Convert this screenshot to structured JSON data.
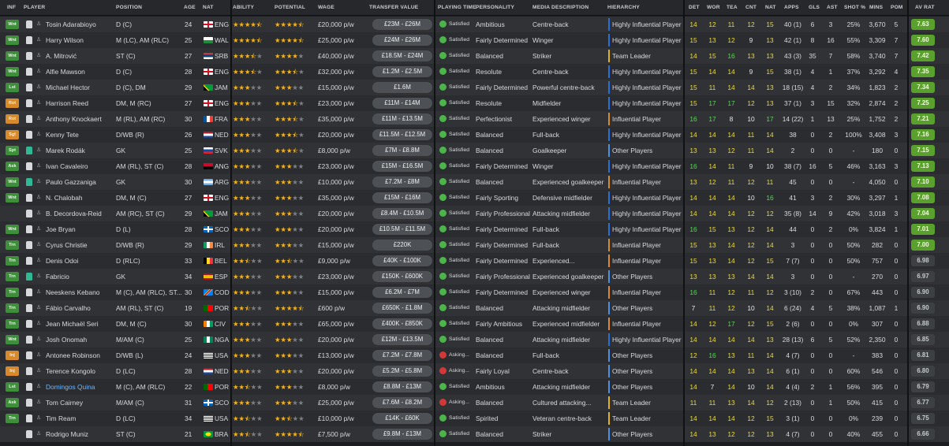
{
  "headers": {
    "inf": "INF",
    "player": "PLAYER",
    "position": "POSITION",
    "age": "AGE",
    "nat": "NAT",
    "ability": "ABILITY",
    "potential": "POTENTIAL",
    "wage": "WAGE",
    "transfer_value": "TRANSFER VALUE",
    "playing_time": "PLAYING TIME",
    "personality": "PERSONALITY",
    "media": "MEDIA DESCRIPTION",
    "hierarchy": "HIERARCHY",
    "det": "DET",
    "wor": "WOR",
    "tea": "TEA",
    "cnt": "CNT",
    "nat2": "NAT",
    "apps": "APPS",
    "gls": "GLS",
    "ast": "AST",
    "shot": "SHOT %",
    "mins": "MINS",
    "pom": "POM",
    "avrat": "AV RAT"
  },
  "colors": {
    "inf_wnt": "#3e8e3b",
    "inf_lst": "#3e8e3b",
    "inf_rot": "#d8892a",
    "inf_sgl": "#d8892a",
    "inf_spt": "#3e8e3b",
    "inf_trn": "#3e8e3b",
    "inf_inj": "#d8892a",
    "hier_top": "#2a6fd6",
    "hier_leader": "#e2b21c",
    "hier_infl": "#d8892a",
    "hier_other": "#4d8fe0",
    "star_on": "#f2b31f",
    "star_off": "#7c7f84",
    "satisfied": "#4bb54a",
    "asking": "#d23838"
  },
  "players": [
    {
      "inf": "Wnt",
      "name": "Tosin Adarabioyo",
      "pos": "D (C)",
      "age": "24",
      "nat": "ENG",
      "ab": 4.5,
      "pot": 4.5,
      "wage": "£20,000 p/w",
      "tv": "£23M - £26M",
      "pt": "Satisfied",
      "pers": "Ambitious",
      "media": "Centre-back",
      "hier": "Highly Influential Player",
      "det": "14",
      "wor": "12",
      "tea": "11",
      "cnt": "12",
      "nat2": "15",
      "apps": "40 (1)",
      "gls": "6",
      "ast": "3",
      "shot": "25%",
      "mins": "3,670",
      "pom": "5",
      "av": "7.63"
    },
    {
      "inf": "Wnt",
      "name": "Harry Wilson",
      "pos": "M (LC), AM (RLC)",
      "age": "25",
      "nat": "WAL",
      "ab": 4.5,
      "pot": 4.5,
      "wage": "£25,000 p/w",
      "tv": "£24M - £26M",
      "pt": "Satisfied",
      "pers": "Fairly Determined",
      "media": "Winger",
      "hier": "Highly Influential Player",
      "det": "15",
      "wor": "13",
      "tea": "12",
      "cnt": "9",
      "nat2": "13",
      "apps": "42 (1)",
      "gls": "8",
      "ast": "16",
      "shot": "55%",
      "mins": "3,309",
      "pom": "7",
      "av": "7.60"
    },
    {
      "inf": "Wnt",
      "name": "A. Mitrović",
      "pos": "ST (C)",
      "age": "27",
      "nat": "SRB",
      "ab": 3.5,
      "pot": 4,
      "wage": "£40,000 p/w",
      "tv": "£18.5M - £24M",
      "pt": "Satisfied",
      "pers": "Balanced",
      "media": "Striker",
      "hier": "Team Leader",
      "det": "14",
      "wor": "15",
      "tea": "16",
      "cnt": "13",
      "nat2": "13",
      "apps": "43 (3)",
      "gls": "35",
      "ast": "7",
      "shot": "58%",
      "mins": "3,740",
      "pom": "7",
      "av": "7.42"
    },
    {
      "inf": "Wnt",
      "name": "Alfie Mawson",
      "pos": "D (C)",
      "age": "28",
      "nat": "ENG",
      "ab": 3.5,
      "pot": 3.5,
      "wage": "£32,000 p/w",
      "tv": "£1.2M - £2.5M",
      "pt": "Satisfied",
      "pers": "Resolute",
      "media": "Centre-back",
      "hier": "Highly Influential Player",
      "det": "15",
      "wor": "14",
      "tea": "14",
      "cnt": "9",
      "nat2": "15",
      "apps": "38 (1)",
      "gls": "4",
      "ast": "1",
      "shot": "37%",
      "mins": "3,292",
      "pom": "4",
      "av": "7.35"
    },
    {
      "inf": "Lst",
      "name": "Michael Hector",
      "pos": "D (C), DM",
      "age": "29",
      "nat": "JAM",
      "ab": 3,
      "pot": 3,
      "wage": "£15,000 p/w",
      "tv": "£1.6M",
      "pt": "Satisfied",
      "pers": "Fairly Determined",
      "media": "Powerful centre-back",
      "hier": "Highly Influential Player",
      "det": "15",
      "wor": "11",
      "tea": "14",
      "cnt": "14",
      "nat2": "13",
      "apps": "18 (15)",
      "gls": "4",
      "ast": "2",
      "shot": "34%",
      "mins": "1,823",
      "pom": "2",
      "av": "7.34"
    },
    {
      "inf": "Rot",
      "name": "Harrison Reed",
      "pos": "DM, M (RC)",
      "age": "27",
      "nat": "ENG",
      "ab": 3,
      "pot": 3.5,
      "wage": "£23,000 p/w",
      "tv": "£11M - £14M",
      "pt": "Satisfied",
      "pers": "Resolute",
      "media": "Midfielder",
      "hier": "Highly Influential Player",
      "det": "15",
      "wor": "17",
      "tea": "17",
      "cnt": "12",
      "nat2": "13",
      "apps": "37 (1)",
      "gls": "3",
      "ast": "15",
      "shot": "32%",
      "mins": "2,874",
      "pom": "2",
      "av": "7.25"
    },
    {
      "inf": "Rot",
      "name": "Anthony Knockaert",
      "pos": "M (RL), AM (RC)",
      "age": "30",
      "nat": "FRA",
      "ab": 3,
      "pot": 3.5,
      "wage": "£35,000 p/w",
      "tv": "£11M - £13.5M",
      "pt": "Satisfied",
      "pers": "Perfectionist",
      "media": "Experienced winger",
      "hier": "Influential Player",
      "det": "16",
      "wor": "17",
      "tea": "8",
      "cnt": "10",
      "nat2": "17",
      "apps": "14 (22)",
      "gls": "1",
      "ast": "13",
      "shot": "25%",
      "mins": "1,752",
      "pom": "2",
      "av": "7.21"
    },
    {
      "inf": "Sgl",
      "name": "Kenny Tete",
      "pos": "D/WB (R)",
      "age": "26",
      "nat": "NED",
      "ab": 3,
      "pot": 3.5,
      "wage": "£20,000 p/w",
      "tv": "£11.5M - £12.5M",
      "pt": "Satisfied",
      "pers": "Balanced",
      "media": "Full-back",
      "hier": "Highly Influential Player",
      "det": "14",
      "wor": "14",
      "tea": "14",
      "cnt": "11",
      "nat2": "14",
      "apps": "38",
      "gls": "0",
      "ast": "2",
      "shot": "100%",
      "mins": "3,408",
      "pom": "3",
      "av": "7.16"
    },
    {
      "inf": "Spt",
      "name": "Marek Rodák",
      "pos": "GK",
      "age": "25",
      "nat": "SVK",
      "ab": 3,
      "pot": 3.5,
      "wage": "£8,000 p/w",
      "tv": "£7M - £8.8M",
      "pt": "Satisfied",
      "pers": "Balanced",
      "media": "Goalkeeper",
      "hier": "Other Players",
      "det": "13",
      "wor": "13",
      "tea": "12",
      "cnt": "11",
      "nat2": "14",
      "apps": "2",
      "gls": "0",
      "ast": "0",
      "shot": "-",
      "mins": "180",
      "pom": "0",
      "av": "7.15",
      "gk": true
    },
    {
      "inf": "Ask",
      "name": "Ivan Cavaleiro",
      "pos": "AM (RL), ST (C)",
      "age": "28",
      "nat": "ANG",
      "ab": 3,
      "pot": 3,
      "wage": "£23,000 p/w",
      "tv": "£15M - £16.5M",
      "pt": "Satisfied",
      "pers": "Fairly Determined",
      "media": "Winger",
      "hier": "Highly Influential Player",
      "det": "16",
      "wor": "14",
      "tea": "11",
      "cnt": "9",
      "nat2": "10",
      "apps": "38 (7)",
      "gls": "16",
      "ast": "5",
      "shot": "46%",
      "mins": "3,163",
      "pom": "3",
      "av": "7.13"
    },
    {
      "inf": "Wnt",
      "name": "Paulo Gazzaniga",
      "pos": "GK",
      "age": "30",
      "nat": "ARG",
      "ab": 3,
      "pot": 3,
      "wage": "£10,000 p/w",
      "tv": "£7.2M - £8M",
      "pt": "Satisfied",
      "pers": "Balanced",
      "media": "Experienced goalkeeper",
      "hier": "Influential Player",
      "det": "13",
      "wor": "12",
      "tea": "11",
      "cnt": "12",
      "nat2": "11",
      "apps": "45",
      "gls": "0",
      "ast": "0",
      "shot": "-",
      "mins": "4,050",
      "pom": "0",
      "av": "7.10",
      "gk": true
    },
    {
      "inf": "Wnt",
      "name": "N. Chalobah",
      "pos": "DM, M (C)",
      "age": "27",
      "nat": "ENG",
      "ab": 3,
      "pot": 3,
      "wage": "£35,000 p/w",
      "tv": "£15M - £16M",
      "pt": "Satisfied",
      "pers": "Fairly Sporting",
      "media": "Defensive midfielder",
      "hier": "Highly Influential Player",
      "det": "14",
      "wor": "14",
      "tea": "14",
      "cnt": "10",
      "nat2": "16",
      "apps": "41",
      "gls": "3",
      "ast": "2",
      "shot": "30%",
      "mins": "3,297",
      "pom": "1",
      "av": "7.08"
    },
    {
      "inf": "",
      "name": "B. Decordova-Reid",
      "pos": "AM (RC), ST (C)",
      "age": "29",
      "nat": "JAM",
      "ab": 3,
      "pot": 3,
      "wage": "£20,000 p/w",
      "tv": "£8.4M - £10.5M",
      "pt": "Satisfied",
      "pers": "Fairly Professional",
      "media": "Attacking midfielder",
      "hier": "Highly Influential Player",
      "det": "14",
      "wor": "14",
      "tea": "14",
      "cnt": "12",
      "nat2": "12",
      "apps": "35 (8)",
      "gls": "14",
      "ast": "9",
      "shot": "42%",
      "mins": "3,018",
      "pom": "3",
      "av": "7.04"
    },
    {
      "inf": "Wnt",
      "name": "Joe Bryan",
      "pos": "D (L)",
      "age": "28",
      "nat": "SCO",
      "ab": 3,
      "pot": 3,
      "wage": "£20,000 p/w",
      "tv": "£10.5M - £11.5M",
      "pt": "Satisfied",
      "pers": "Fairly Determined",
      "media": "Full-back",
      "hier": "Highly Influential Player",
      "det": "16",
      "wor": "15",
      "tea": "13",
      "cnt": "12",
      "nat2": "14",
      "apps": "44",
      "gls": "0",
      "ast": "2",
      "shot": "0%",
      "mins": "3,824",
      "pom": "1",
      "av": "7.01"
    },
    {
      "inf": "Trn",
      "name": "Cyrus Christie",
      "pos": "D/WB (R)",
      "age": "29",
      "nat": "IRL",
      "ab": 3,
      "pot": 3,
      "wage": "£15,000 p/w",
      "tv": "£220K",
      "pt": "Satisfied",
      "pers": "Fairly Determined",
      "media": "Full-back",
      "hier": "Influential Player",
      "det": "15",
      "wor": "13",
      "tea": "14",
      "cnt": "12",
      "nat2": "14",
      "apps": "3",
      "gls": "0",
      "ast": "0",
      "shot": "50%",
      "mins": "282",
      "pom": "0",
      "av": "7.00"
    },
    {
      "inf": "Trn",
      "name": "Denis Odoi",
      "pos": "D (RLC)",
      "age": "33",
      "nat": "BEL",
      "ab": 2.5,
      "pot": 2.5,
      "wage": "£9,000 p/w",
      "tv": "£40K - £100K",
      "pt": "Satisfied",
      "pers": "Fairly Determined",
      "media": "Experienced...",
      "hier": "Influential Player",
      "det": "15",
      "wor": "13",
      "tea": "14",
      "cnt": "12",
      "nat2": "15",
      "apps": "7 (7)",
      "gls": "0",
      "ast": "0",
      "shot": "50%",
      "mins": "757",
      "pom": "0",
      "av": "6.98"
    },
    {
      "inf": "Trn",
      "name": "Fabricio",
      "pos": "GK",
      "age": "34",
      "nat": "ESP",
      "ab": 3,
      "pot": 3,
      "wage": "£23,000 p/w",
      "tv": "£150K - £600K",
      "pt": "Satisfied",
      "pers": "Fairly Professional",
      "media": "Experienced goalkeeper",
      "hier": "Other Players",
      "det": "13",
      "wor": "13",
      "tea": "13",
      "cnt": "14",
      "nat2": "14",
      "apps": "3",
      "gls": "0",
      "ast": "0",
      "shot": "-",
      "mins": "270",
      "pom": "0",
      "av": "6.97",
      "gk": true
    },
    {
      "inf": "Trn",
      "name": "Neeskens Kebano",
      "pos": "M (C), AM (RLC), ST...",
      "age": "30",
      "nat": "COD",
      "ab": 3,
      "pot": 3,
      "wage": "£15,000 p/w",
      "tv": "£6.2M - £7M",
      "pt": "Satisfied",
      "pers": "Fairly Determined",
      "media": "Experienced winger",
      "hier": "Influential Player",
      "det": "16",
      "wor": "11",
      "tea": "12",
      "cnt": "11",
      "nat2": "12",
      "apps": "3 (10)",
      "gls": "2",
      "ast": "0",
      "shot": "67%",
      "mins": "443",
      "pom": "0",
      "av": "6.90"
    },
    {
      "inf": "Trn",
      "name": "Fábio Carvalho",
      "pos": "AM (RL), ST (C)",
      "age": "19",
      "nat": "POR",
      "ab": 2.5,
      "pot": 4.5,
      "wage": "£600 p/w",
      "tv": "£650K - £1.8M",
      "pt": "Satisfied",
      "pers": "Balanced",
      "media": "Attacking midfielder",
      "hier": "Other Players",
      "det": "7",
      "wor": "11",
      "tea": "12",
      "cnt": "10",
      "nat2": "14",
      "apps": "6 (24)",
      "gls": "4",
      "ast": "5",
      "shot": "38%",
      "mins": "1,087",
      "pom": "1",
      "av": "6.90"
    },
    {
      "inf": "Trn",
      "name": "Jean Michaël Seri",
      "pos": "DM, M (C)",
      "age": "30",
      "nat": "CIV",
      "ab": 3,
      "pot": 3,
      "wage": "£65,000 p/w",
      "tv": "£400K - £850K",
      "pt": "Satisfied",
      "pers": "Fairly Ambitious",
      "media": "Experienced midfielder",
      "hier": "Influential Player",
      "det": "14",
      "wor": "12",
      "tea": "17",
      "cnt": "12",
      "nat2": "15",
      "apps": "2 (6)",
      "gls": "0",
      "ast": "0",
      "shot": "0%",
      "mins": "307",
      "pom": "0",
      "av": "6.88"
    },
    {
      "inf": "Wnt",
      "name": "Josh Onomah",
      "pos": "M/AM (C)",
      "age": "25",
      "nat": "NGA",
      "ab": 3,
      "pot": 3,
      "wage": "£20,000 p/w",
      "tv": "£12M - £13.5M",
      "pt": "Satisfied",
      "pers": "Balanced",
      "media": "Attacking midfielder",
      "hier": "Highly Influential Player",
      "det": "14",
      "wor": "14",
      "tea": "14",
      "cnt": "14",
      "nat2": "13",
      "apps": "28 (13)",
      "gls": "6",
      "ast": "5",
      "shot": "52%",
      "mins": "2,350",
      "pom": "0",
      "av": "6.85"
    },
    {
      "inf": "Inj",
      "name": "Antonee Robinson",
      "pos": "D/WB (L)",
      "age": "24",
      "nat": "USA",
      "ab": 3,
      "pot": 3,
      "wage": "£13,000 p/w",
      "tv": "£7.2M - £7.8M",
      "pt": "Asking...",
      "pers": "Balanced",
      "media": "Full-back",
      "hier": "Other Players",
      "det": "12",
      "wor": "16",
      "tea": "13",
      "cnt": "11",
      "nat2": "14",
      "apps": "4 (7)",
      "gls": "0",
      "ast": "0",
      "shot": "-",
      "mins": "383",
      "pom": "0",
      "av": "6.81"
    },
    {
      "inf": "Inj",
      "name": "Terence Kongolo",
      "pos": "D (LC)",
      "age": "28",
      "nat": "NED",
      "ab": 3,
      "pot": 3,
      "wage": "£20,000 p/w",
      "tv": "£5.2M - £5.8M",
      "pt": "Asking...",
      "pers": "Fairly Loyal",
      "media": "Centre-back",
      "hier": "Other Players",
      "det": "14",
      "wor": "14",
      "tea": "14",
      "cnt": "13",
      "nat2": "14",
      "apps": "6 (1)",
      "gls": "0",
      "ast": "0",
      "shot": "60%",
      "mins": "546",
      "pom": "0",
      "av": "6.80"
    },
    {
      "inf": "Lst",
      "name": "Domingos Quina",
      "pos": "M (C), AM (RLC)",
      "age": "22",
      "nat": "POR",
      "ab": 2.5,
      "pot": 3,
      "wage": "£8,000 p/w",
      "tv": "£8.8M - £13M",
      "pt": "Satisfied",
      "pers": "Ambitious",
      "media": "Attacking midfielder",
      "hier": "Other Players",
      "det": "14",
      "wor": "7",
      "tea": "14",
      "cnt": "10",
      "nat2": "14",
      "apps": "4 (4)",
      "gls": "2",
      "ast": "1",
      "shot": "56%",
      "mins": "395",
      "pom": "0",
      "av": "6.79",
      "link": true
    },
    {
      "inf": "Ask",
      "name": "Tom Cairney",
      "pos": "M/AM (C)",
      "age": "31",
      "nat": "SCO",
      "ab": 3,
      "pot": 3,
      "wage": "£25,000 p/w",
      "tv": "£7.6M - £8.2M",
      "pt": "Asking...",
      "pers": "Balanced",
      "media": "Cultured attacking...",
      "hier": "Team Leader",
      "det": "11",
      "wor": "11",
      "tea": "13",
      "cnt": "14",
      "nat2": "12",
      "apps": "2 (13)",
      "gls": "0",
      "ast": "1",
      "shot": "50%",
      "mins": "415",
      "pom": "0",
      "av": "6.77"
    },
    {
      "inf": "Trn",
      "name": "Tim Ream",
      "pos": "D (LC)",
      "age": "34",
      "nat": "USA",
      "ab": 2.5,
      "pot": 2.5,
      "wage": "£10,000 p/w",
      "tv": "£14K - £60K",
      "pt": "Satisfied",
      "pers": "Spirited",
      "media": "Veteran centre-back",
      "hier": "Team Leader",
      "det": "14",
      "wor": "14",
      "tea": "14",
      "cnt": "12",
      "nat2": "15",
      "apps": "3 (1)",
      "gls": "0",
      "ast": "0",
      "shot": "0%",
      "mins": "239",
      "pom": "0",
      "av": "6.75"
    },
    {
      "inf": "",
      "name": "Rodrigo Muniz",
      "pos": "ST (C)",
      "age": "21",
      "nat": "BRA",
      "ab": 2.5,
      "pot": 4.5,
      "wage": "£7,500 p/w",
      "tv": "£9.8M - £13M",
      "pt": "Satisfied",
      "pers": "Balanced",
      "media": "Striker",
      "hier": "Other Players",
      "det": "14",
      "wor": "13",
      "tea": "12",
      "cnt": "12",
      "nat2": "13",
      "apps": "4 (7)",
      "gls": "0",
      "ast": "0",
      "shot": "40%",
      "mins": "455",
      "pom": "0",
      "av": "6.66"
    }
  ]
}
